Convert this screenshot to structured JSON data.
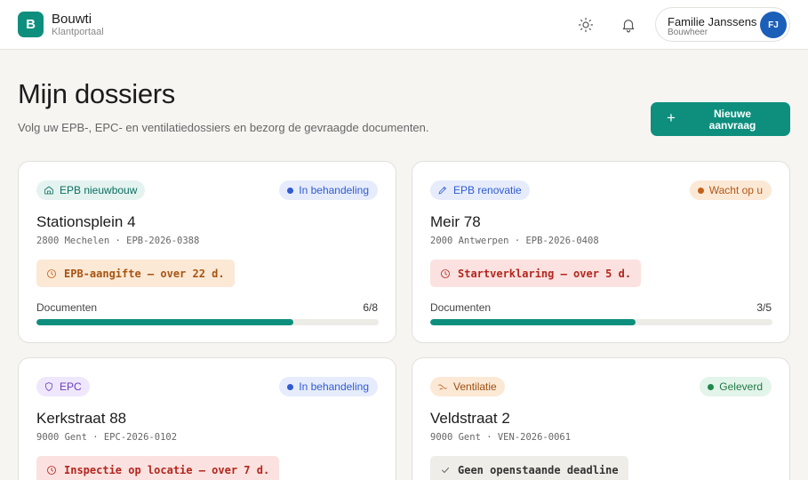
{
  "header": {
    "logo_letter": "B",
    "brand": "Bouwti",
    "brand_sub": "Klantportaal",
    "user": {
      "name": "Familie Janssens",
      "role": "Bouwheer",
      "initials": "FJ"
    },
    "icons": [
      "sun-icon",
      "bell-icon"
    ]
  },
  "page": {
    "title": "Mijn dossiers",
    "subtitle": "Volg uw EPB-, EPC- en ventilatiedossiers en bezorg de gevraagde documenten.",
    "new_button_icon": "+",
    "new_button_label": "Nieuwe aanvraag"
  },
  "colors": {
    "accent": "#0e8f7e",
    "status_blue": "#2f5bd3",
    "status_orange": "#c2611a",
    "status_green": "#1f8a4c",
    "deadline_red": "#b3261e"
  },
  "dossiers": [
    {
      "type": "EPB nieuwbouw",
      "type_icon": "house-icon",
      "status": "In behandeling",
      "address": "Stationsplein 4",
      "meta": "2800 Mechelen · EPB-2026-0388",
      "deadline": "EPB-aangifte — over 22 d.",
      "deadline_icon": "clock-icon",
      "docs_label": "Documenten",
      "docs_count": "6/8",
      "docs_done": 6,
      "docs_total": 8
    },
    {
      "type": "EPB renovatie",
      "type_icon": "pencil-icon",
      "status": "Wacht op u",
      "address": "Meir 78",
      "meta": "2000 Antwerpen · EPB-2026-0408",
      "deadline": "Startverklaring — over 5 d.",
      "deadline_icon": "clock-icon",
      "docs_label": "Documenten",
      "docs_count": "3/5",
      "docs_done": 3,
      "docs_total": 5
    },
    {
      "type": "EPC",
      "type_icon": "shield-icon",
      "status": "In behandeling",
      "address": "Kerkstraat 88",
      "meta": "9000 Gent · EPC-2026-0102",
      "deadline": "Inspectie op locatie — over 7 d.",
      "deadline_icon": "clock-icon"
    },
    {
      "type": "Ventilatie",
      "type_icon": "fan-icon",
      "status": "Geleverd",
      "address": "Veldstraat 2",
      "meta": "9000 Gent · VEN-2026-0061",
      "deadline": "Geen openstaande deadline",
      "deadline_icon": "check-icon"
    }
  ]
}
